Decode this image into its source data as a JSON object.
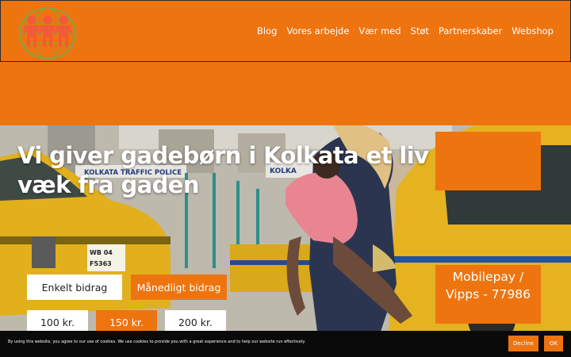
{
  "colors": {
    "brand_orange": "#ee7410",
    "cookie_bar": "#0a0a0a",
    "white": "#ffffff"
  },
  "header": {
    "logo_icon": "children-globe-logo",
    "nav": [
      "Blog",
      "Vores arbejde",
      "Vær med",
      "Støt",
      "Partnerskaber",
      "Webshop"
    ]
  },
  "hero": {
    "headline": "Vi giver gadebørn i Kolkata et liv væk fra gaden",
    "sign_text_1": "KOLKATA TRAFFIC POLICE",
    "sign_text_2": "KOLKA",
    "plate_line1": "WB 04",
    "plate_line2": "F5363"
  },
  "donation": {
    "single_label": "Enkelt bidrag",
    "monthly_label": "Månedligt bidrag",
    "amounts": [
      "100 kr.",
      "150 kr.",
      "200 kr."
    ],
    "selected_amount": "150 kr.",
    "mobilepay_label": "Mobilepay / Vipps - 77986"
  },
  "cookie": {
    "text": "By using this website, you agree to our use of cookies. We use cookies to provide you with a great experience and to help our website run effectively.",
    "decline_label": "Decline",
    "ok_label": "OK"
  }
}
